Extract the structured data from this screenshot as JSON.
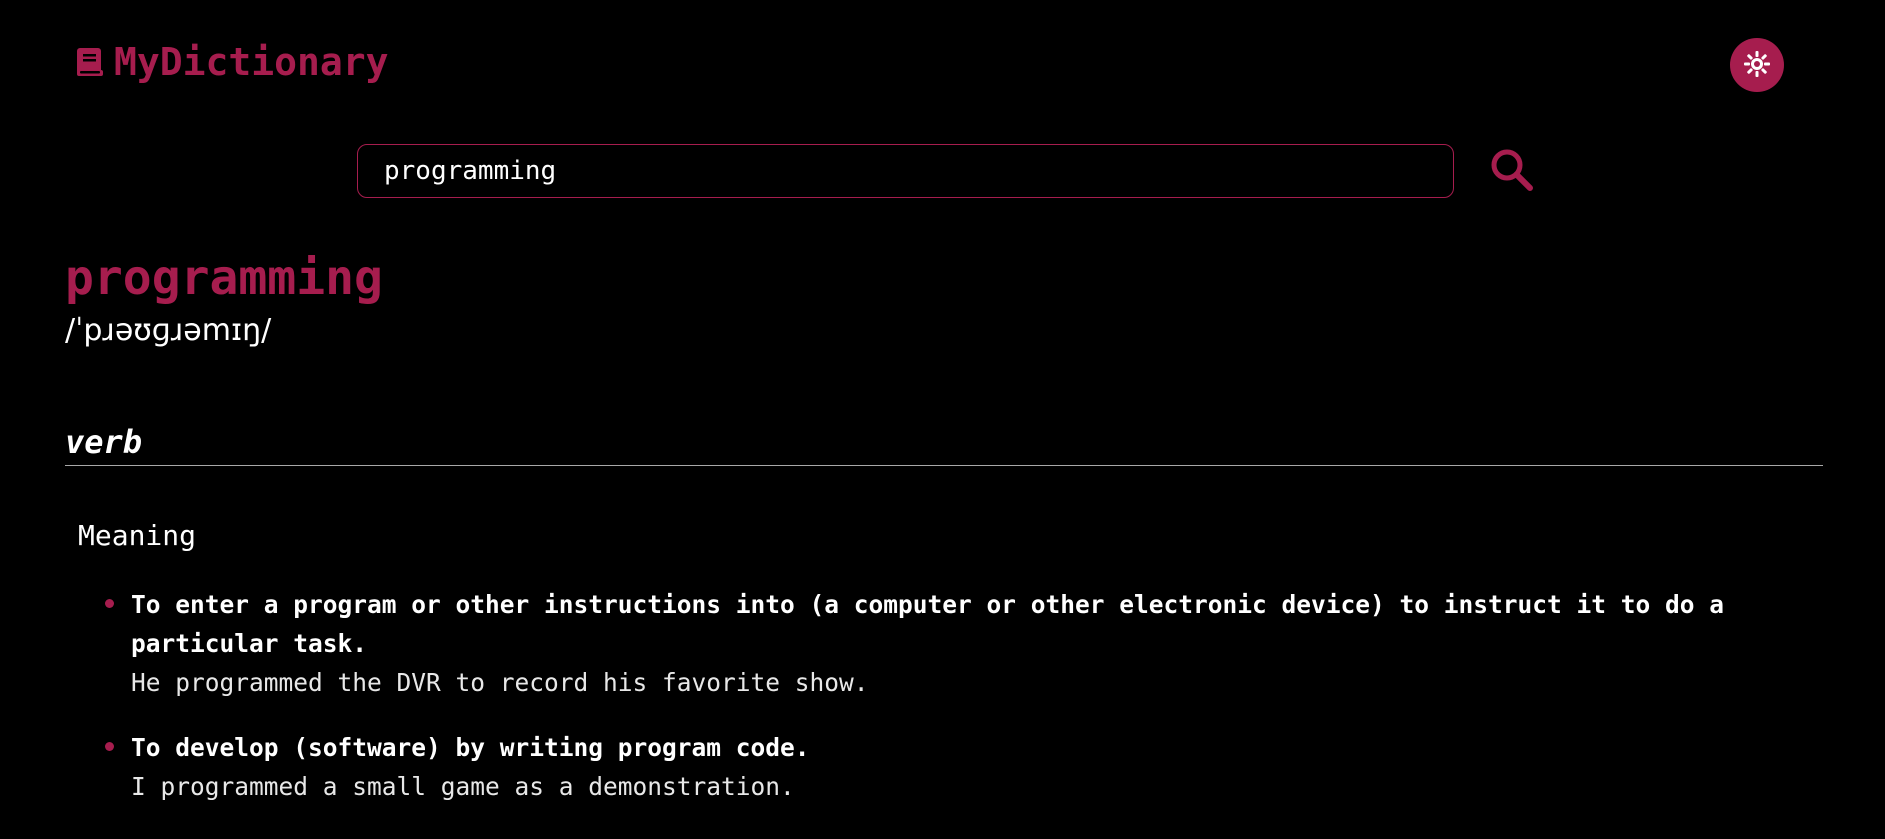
{
  "app": {
    "name": "MyDictionary",
    "brand_color": "#a61d4e",
    "logo_icon": "book-icon",
    "theme_toggle_icon": "sun-icon"
  },
  "search": {
    "value": "programming",
    "button_icon": "search-icon"
  },
  "entry": {
    "word": "programming",
    "phonetic": "/ˈpɹəʊɡɹəmɪŋ/",
    "part_of_speech": "verb",
    "meaning_heading": "Meaning",
    "definitions": [
      {
        "text": "To enter a program or other instructions into (a computer or other electronic device) to instruct it to do a particular task.",
        "example": "He programmed the DVR to record his favorite show."
      },
      {
        "text": "To develop (software) by writing program code.",
        "example": "I programmed a small game as a demonstration."
      }
    ]
  }
}
